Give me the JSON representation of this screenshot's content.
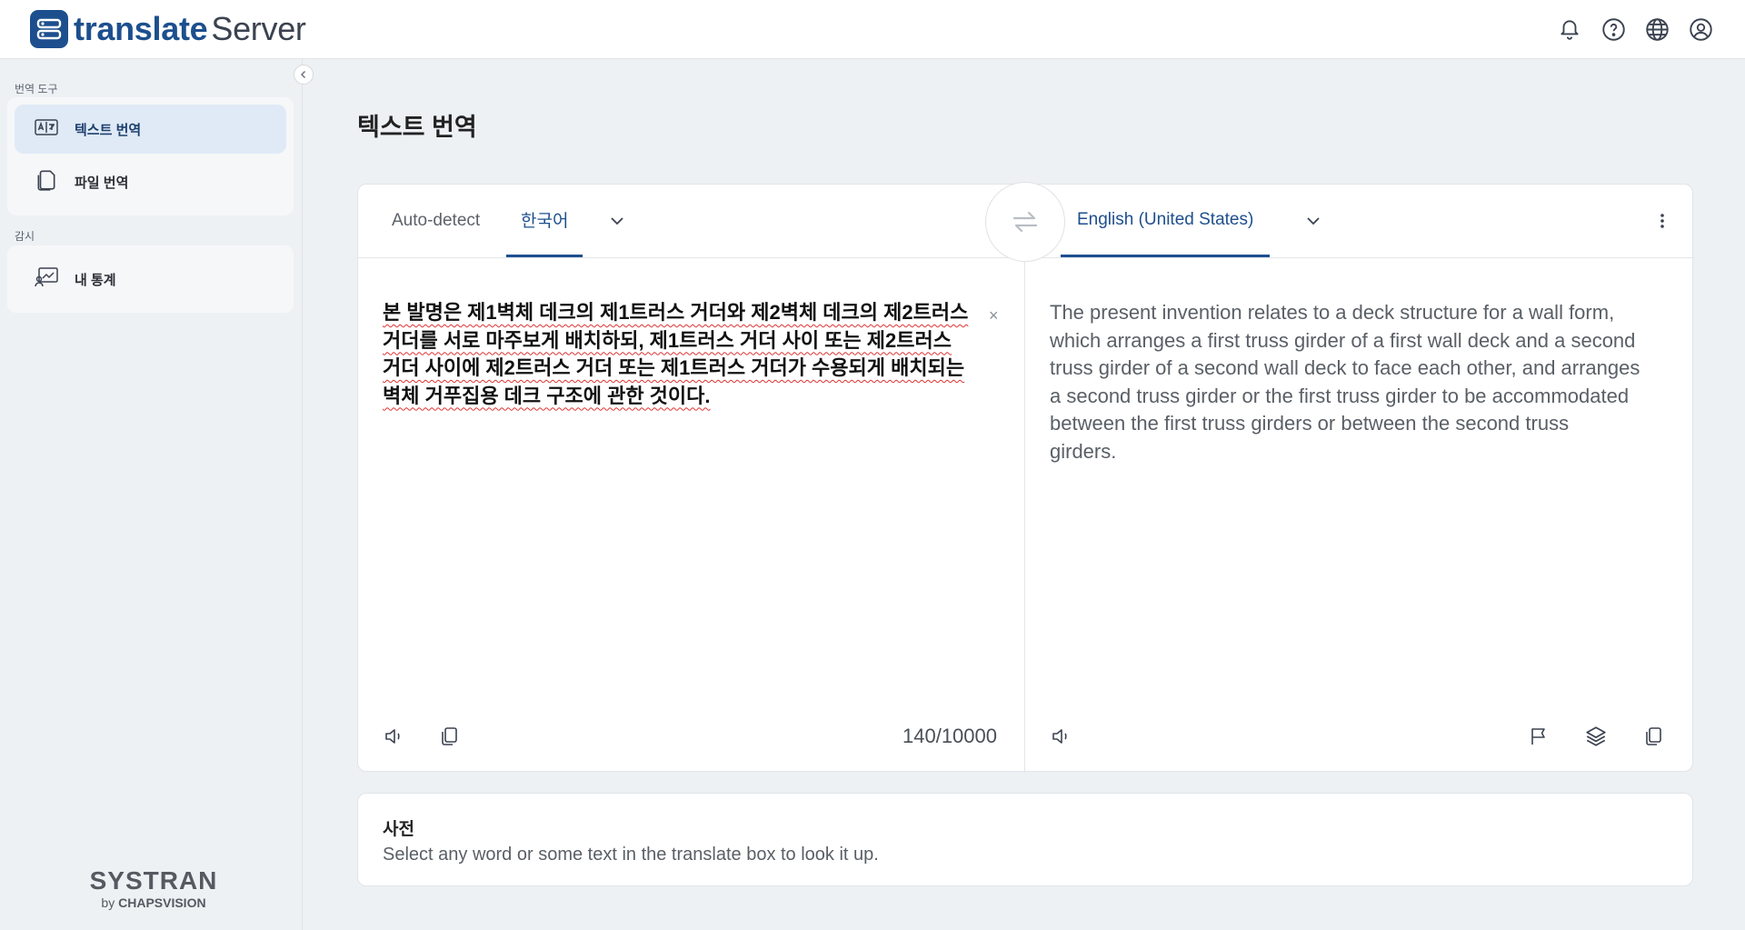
{
  "header": {
    "logo_primary": "translate",
    "logo_secondary": "Server",
    "icons": [
      "bell-icon",
      "help-icon",
      "globe-icon",
      "account-icon"
    ]
  },
  "sidebar": {
    "section_tools": "번역 도구",
    "items": [
      {
        "label": "텍스트 번역",
        "icon": "text-translate-icon",
        "active": true
      },
      {
        "label": "파일 번역",
        "icon": "file-icon",
        "active": false
      }
    ],
    "section_monitor": "감시",
    "monitor_items": [
      {
        "label": "내 통계",
        "icon": "statistics-icon"
      }
    ],
    "brand_name": "SYSTRAN",
    "brand_by": "by",
    "brand_company": "CHAPSVISION"
  },
  "main": {
    "title": "텍스트 번역",
    "source": {
      "auto_detect": "Auto-detect",
      "language": "한국어",
      "text": "본 발명은 제1벽체 데크의 제1트러스 거더와 제2벽체 데크의 제2트러스 거더를 서로 마주보게 배치하되, 제1트러스 거더 사이 또는 제2트러스 거더 사이에 제2트러스 거더 또는 제1트러스 거더가 수용되게 배치되는 벽체 거푸집용 데크 구조에 관한 것이다.",
      "char_count": "140/10000",
      "clear": "×"
    },
    "target": {
      "language": "English (United States)",
      "text": "The present invention relates to a deck structure for a wall form, which arranges a first truss girder of a first wall deck and a second truss girder of a second wall deck to face each other, and arranges a second truss girder or the first truss girder to be accommodated between the first truss girders or between the second truss girders."
    },
    "dictionary": {
      "title": "사전",
      "hint": "Select any word or some text in the translate box to look it up."
    }
  },
  "colors": {
    "accent": "#1d4f8e",
    "active_bg": "#dfeaf6",
    "page_bg": "#eef1f4"
  }
}
